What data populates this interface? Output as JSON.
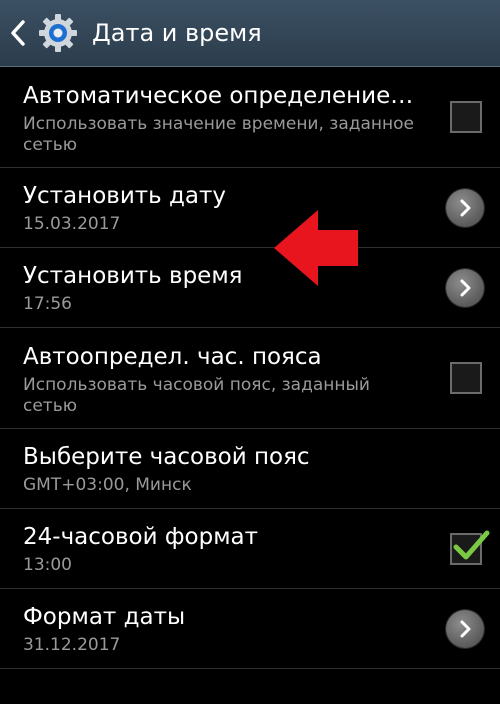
{
  "header": {
    "title": "Дата и время",
    "back_icon": "chevron-left-icon",
    "app_icon": "settings-gear-icon"
  },
  "settings": [
    {
      "title": "Автоматическое определение…",
      "summary": "Использовать значение времени, заданное сетью",
      "control": "checkbox",
      "checked": false
    },
    {
      "title": "Установить дату",
      "summary": "15.03.2017",
      "control": "chevron"
    },
    {
      "title": "Установить время",
      "summary": "17:56",
      "control": "chevron"
    },
    {
      "title": "Автоопредел. час. пояса",
      "summary": "Использовать часовой пояс, заданный сетью",
      "control": "checkbox",
      "checked": false
    },
    {
      "title": "Выберите часовой пояс",
      "summary": "GMT+03:00, Минск",
      "control": "none"
    },
    {
      "title": "24-часовой формат",
      "summary": "13:00",
      "control": "checkbox",
      "checked": true
    },
    {
      "title": "Формат даты",
      "summary": "31.12.2017",
      "control": "chevron"
    }
  ],
  "colors": {
    "background": "#000000",
    "action_bar": "#34495a",
    "check_mark": "#7ac943",
    "annotation_arrow": "#e8141e"
  }
}
